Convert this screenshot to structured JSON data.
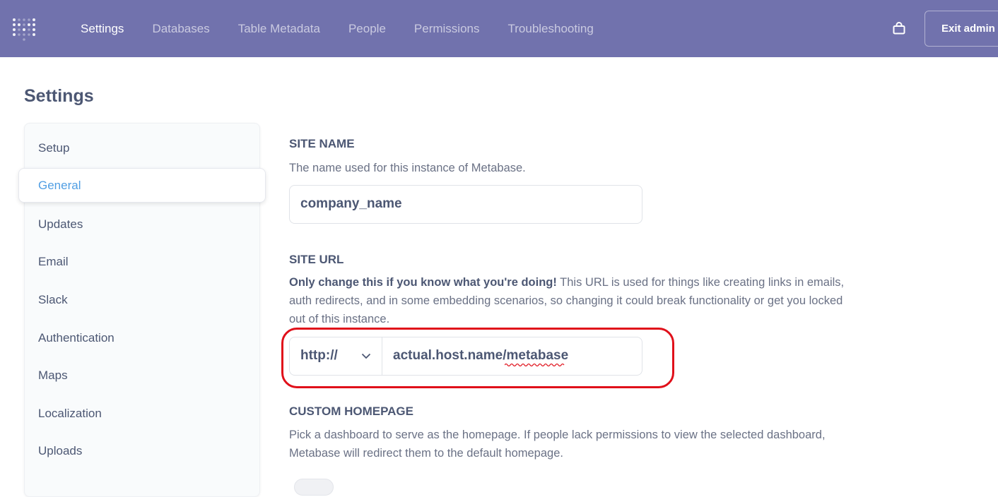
{
  "topbar": {
    "nav": [
      "Settings",
      "Databases",
      "Table Metadata",
      "People",
      "Permissions",
      "Troubleshooting"
    ],
    "active_nav": "Settings",
    "exit_label": "Exit admin"
  },
  "page": {
    "title": "Settings"
  },
  "sidebar": {
    "items": [
      {
        "label": "Setup"
      },
      {
        "label": "General"
      },
      {
        "label": "Updates"
      },
      {
        "label": "Email"
      },
      {
        "label": "Slack"
      },
      {
        "label": "Authentication"
      },
      {
        "label": "Maps"
      },
      {
        "label": "Localization"
      },
      {
        "label": "Uploads"
      }
    ],
    "active": "General"
  },
  "site_name": {
    "label": "SITE NAME",
    "description": "The name used for this instance of Metabase.",
    "value": "company_name"
  },
  "site_url": {
    "label": "SITE URL",
    "warning": "Only change this if you know what you're doing!",
    "description": " This URL is used for things like creating links in emails, auth redirects, and in some embedding scenarios, so changing it could break functionality or get you locked out of this instance.",
    "protocol": "http://",
    "value": "actual.host.name/metabase"
  },
  "custom_homepage": {
    "label": "CUSTOM HOMEPAGE",
    "description": "Pick a dashboard to serve as the homepage. If people lack permissions to view the selected dashboard, Metabase will redirect them to the default homepage."
  },
  "colors": {
    "topbar": "#7172ad",
    "accent": "#509ee3",
    "highlight": "#e0101a"
  }
}
